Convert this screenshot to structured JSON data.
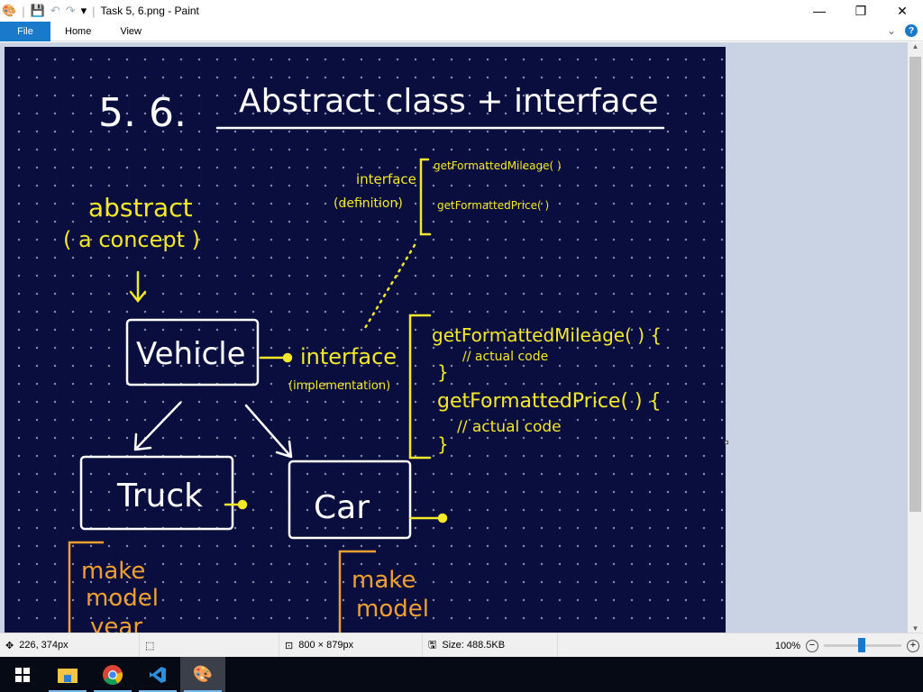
{
  "window": {
    "title": "Task 5, 6.png - Paint",
    "minimize": "—",
    "maximize": "❐",
    "close": "✕"
  },
  "ribbon": {
    "tabs": [
      "File",
      "Home",
      "View"
    ],
    "collapse": "⌄",
    "help": "?"
  },
  "drawing": {
    "heading_number": "5. 6.",
    "heading": "Abstract class + interface",
    "abstract_label": "abstract",
    "abstract_sub": "( a  concept )",
    "vehicle": "Vehicle",
    "truck": "Truck",
    "car": "Car",
    "interface_def_label": "interface",
    "interface_def_sub": "(definition)",
    "interface_def_methods": [
      "getFormattedMileage( )",
      "getFormattedPrice( )"
    ],
    "interface_impl_label": "interface",
    "interface_impl_sub": "(implementation)",
    "impl_lines": [
      "getFormattedMileage( ) {",
      "// actual code",
      "}",
      "getFormattedPrice( ) {",
      "// actual code",
      "}"
    ],
    "truck_fields": [
      "make",
      "model",
      "year"
    ],
    "car_fields": [
      "make",
      "model"
    ],
    "colors": {
      "background": "#0a0e3e",
      "white": "#ffffff",
      "yellow": "#f4e82a",
      "orange": "#f0a030"
    }
  },
  "status": {
    "cursor": "226, 374px",
    "selection": "",
    "image_size": "800 × 879px",
    "file_size": "Size: 488.5KB",
    "zoom": "100%",
    "zoom_level_percent": 100
  },
  "taskbar": {
    "apps": [
      "start",
      "file-explorer",
      "chrome",
      "vscode",
      "paint"
    ]
  }
}
